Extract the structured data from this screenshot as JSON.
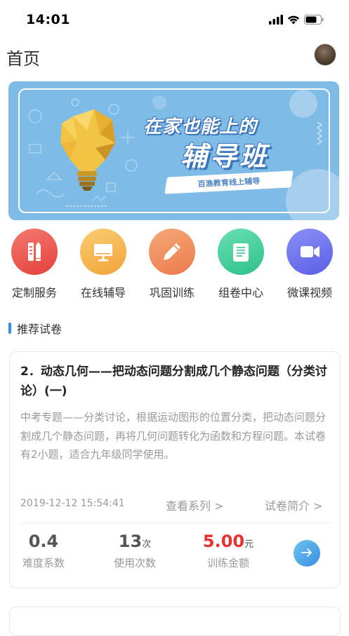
{
  "status_bar": {
    "time": "14:01"
  },
  "header": {
    "title": "首页"
  },
  "banner": {
    "headline_line1": "在家也能上的",
    "headline_line2": "辅导班",
    "slogan": "百渔教育线上辅导",
    "background_color": "#7ebbe6"
  },
  "quick_menu": [
    {
      "label": "定制服务",
      "icon": "ruler-pencil-icon",
      "color": "#ee5a55"
    },
    {
      "label": "在线辅导",
      "icon": "monitor-icon",
      "color": "#f5b44e"
    },
    {
      "label": "巩固训练",
      "icon": "pencil-icon",
      "color": "#f08a55"
    },
    {
      "label": "组卷中心",
      "icon": "scroll-icon",
      "color": "#3fcf9a"
    },
    {
      "label": "微课视频",
      "icon": "video-camera-icon",
      "color": "#6b74ee"
    }
  ],
  "section": {
    "title": "推荐试卷",
    "accent_color": "#2e8ef0"
  },
  "paper_card": {
    "title": "2．动态几何——把动态问题分割成几个静态问题（分类讨论）(一)",
    "description": "中考专题——分类讨论，根据运动图形的位置分类，把动态问题分割成几个静态问题，再将几何问题转化为函数和方程问题。本试卷有2小题，适合九年级同学使用。",
    "date": "2019-12-12 15:54:41",
    "link_series": "查看系列 >",
    "link_intro": "试卷简介 >",
    "stats": {
      "difficulty_value": "0.4",
      "difficulty_label": "难度系数",
      "usage_value": "13",
      "usage_unit": "次",
      "usage_label": "使用次数",
      "price_value": "5.00",
      "price_unit": "元",
      "price_label": "训练金额"
    },
    "price_color": "#e8302e"
  }
}
